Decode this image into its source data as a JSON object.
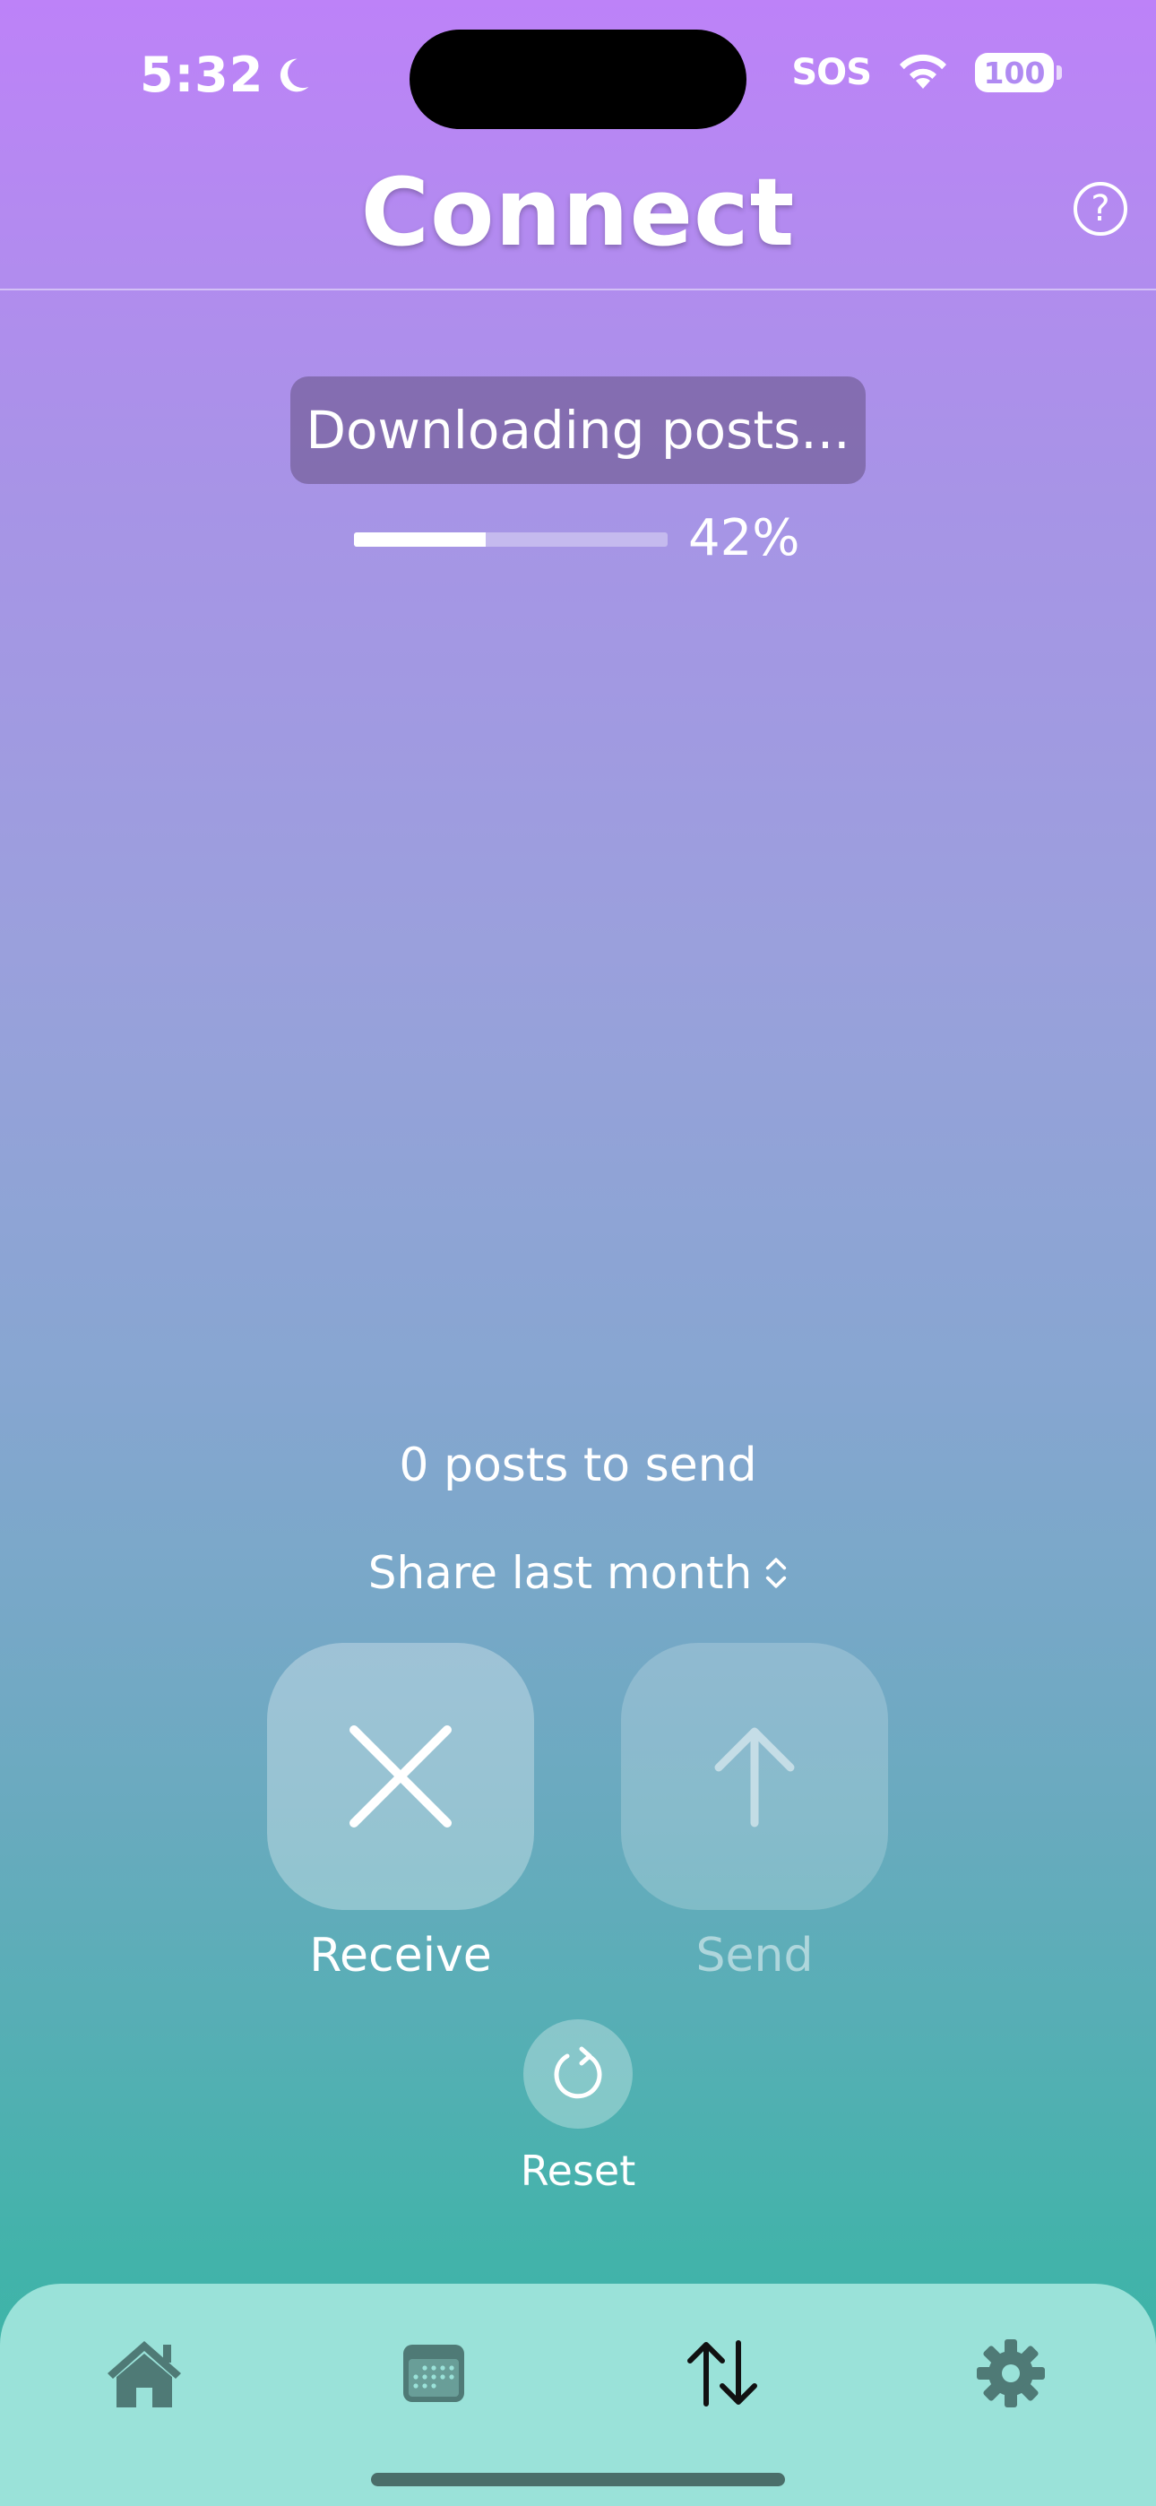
{
  "status_bar": {
    "time": "5:32",
    "carrier": "SOS",
    "battery": "100"
  },
  "header": {
    "title": "Connect",
    "help_glyph": "?"
  },
  "download": {
    "status_text": "Downloading posts...",
    "progress_percent": 42,
    "progress_label": "42%"
  },
  "send_panel": {
    "posts_to_send": "0 posts to send",
    "share_option": "Share last month"
  },
  "actions": {
    "receive_label": "Receive",
    "send_label": "Send",
    "reset_label": "Reset"
  },
  "tab_bar": {
    "items": [
      {
        "icon": "home-icon",
        "active": false
      },
      {
        "icon": "calendar-icon",
        "active": false
      },
      {
        "icon": "transfer-arrows-icon",
        "active": true
      },
      {
        "icon": "gear-icon",
        "active": false
      }
    ]
  },
  "colors": {
    "gradient_top": "#bd82f8",
    "gradient_bottom": "#3ab5a6",
    "tab_bar_bg": "#9ae2d9",
    "tab_icon_inactive": "#4f7a76",
    "tab_icon_active": "#111111"
  }
}
